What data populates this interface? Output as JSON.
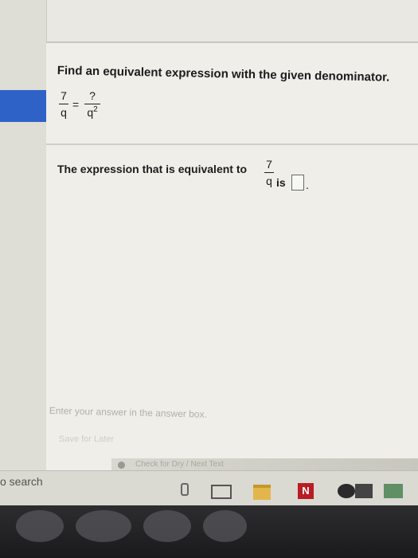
{
  "question": {
    "instruction": "Find an equivalent expression with the given denominator.",
    "equation": {
      "left_num": "7",
      "left_den": "q",
      "equals": "=",
      "right_num": "?",
      "right_den_base": "q",
      "right_den_exp": "2"
    },
    "statement_before": "The expression that is equivalent to",
    "inline_frac_num": "7",
    "inline_frac_den": "q",
    "statement_is": "is",
    "period": "."
  },
  "answer_hint": "Enter your answer in the answer box.",
  "save_label": "Save for Later",
  "nav_text": "Check for Dry / Next Text",
  "taskbar": {
    "search_text": "o search",
    "netflix_letter": "N"
  }
}
